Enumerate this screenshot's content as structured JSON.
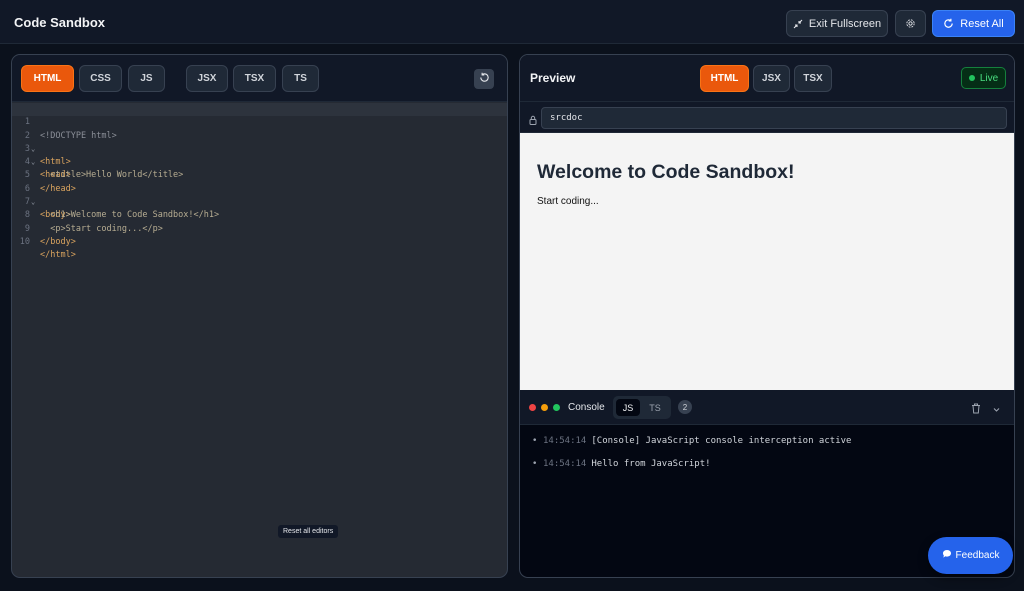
{
  "app": {
    "title": "Code Sandbox"
  },
  "header": {
    "exit_fullscreen": "Exit Fullscreen",
    "reset_all": "Reset All"
  },
  "editor": {
    "tabs": [
      "HTML",
      "CSS",
      "JS",
      "JSX",
      "TSX",
      "TS"
    ],
    "active_tab": "HTML",
    "lines": [
      {
        "n": "1",
        "text": "<!DOCTYPE html>"
      },
      {
        "n": "2",
        "text": "<html>"
      },
      {
        "n": "3",
        "text": "<head>"
      },
      {
        "n": "4",
        "text": "  <title>Hello World</title>"
      },
      {
        "n": "5",
        "text": "</head>"
      },
      {
        "n": "6",
        "text": "<body>"
      },
      {
        "n": "7",
        "text": "  <h1>Welcome to Code Sandbox!</h1>"
      },
      {
        "n": "8",
        "text": "  <p>Start coding...</p>"
      },
      {
        "n": "9",
        "text": "</body>"
      },
      {
        "n": "10",
        "text": "</html>"
      }
    ],
    "tooltip": "Reset all editors"
  },
  "preview": {
    "title": "Preview",
    "tabs": [
      "HTML",
      "JSX",
      "TSX"
    ],
    "active_tab": "HTML",
    "live": "Live",
    "url": "srcdoc",
    "heading": "Welcome to Code Sandbox!",
    "paragraph": "Start coding..."
  },
  "console": {
    "label": "Console",
    "tabs": [
      "JS",
      "TS"
    ],
    "count": "2",
    "logs": [
      {
        "time": "14:54:14",
        "msg": "[Console] JavaScript console interception active"
      },
      {
        "time": "14:54:14",
        "msg": "Hello from JavaScript!"
      }
    ]
  },
  "feedback": "Feedback",
  "colors": {
    "accent": "#ea580c",
    "primary": "#2563eb",
    "live": "#22c55e"
  }
}
